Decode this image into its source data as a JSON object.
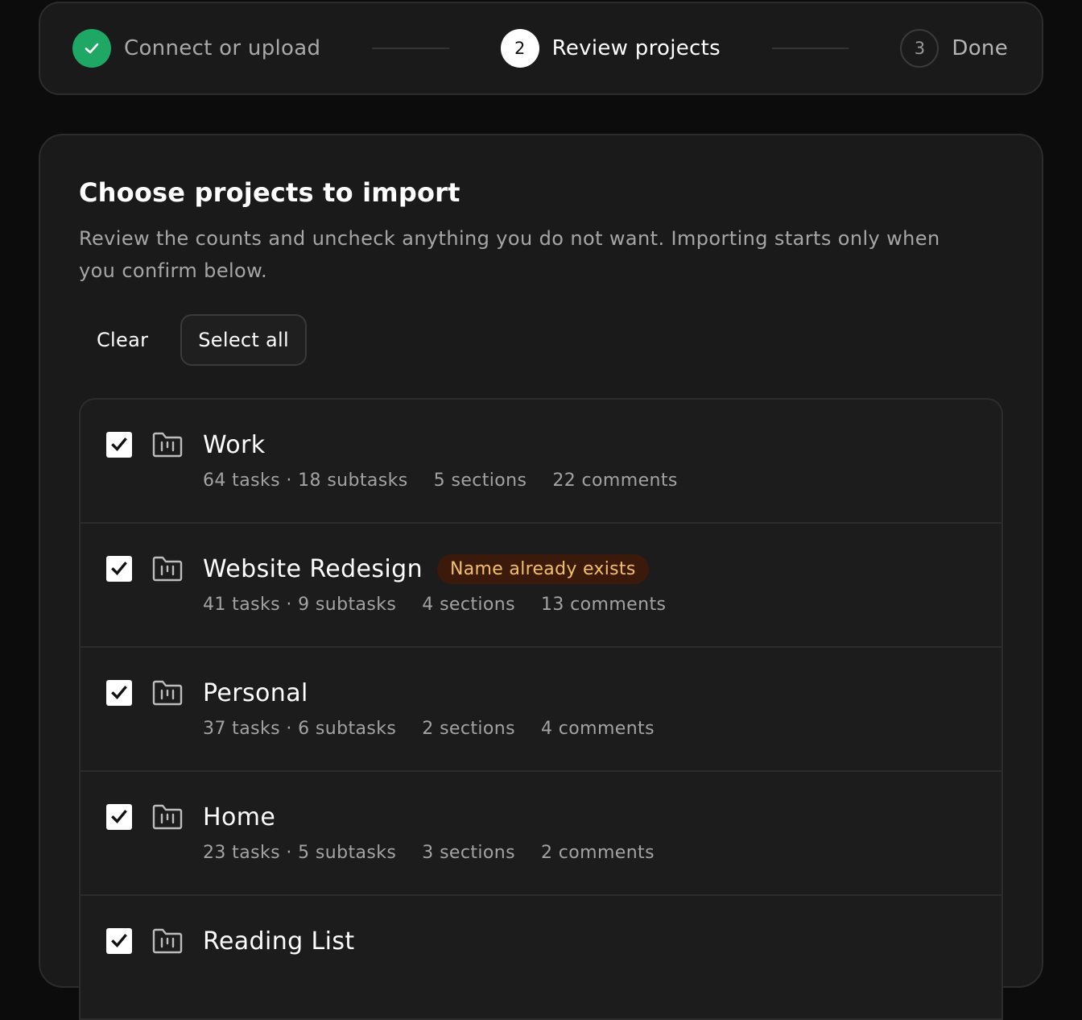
{
  "stepper": {
    "steps": [
      {
        "number": "",
        "label": "Connect or upload",
        "state": "done"
      },
      {
        "number": "2",
        "label": "Review projects",
        "state": "current"
      },
      {
        "number": "3",
        "label": "Done",
        "state": "future"
      }
    ]
  },
  "main": {
    "title": "Choose projects to import",
    "description": "Review the counts and uncheck anything you do not want. Importing starts only when you confirm below.",
    "actions": {
      "clear_label": "Clear",
      "select_all_label": "Select all"
    },
    "projects": [
      {
        "name": "Work",
        "badge": "",
        "tasks": "64 tasks · 18 subtasks",
        "sections": "5 sections",
        "comments": "22 comments",
        "checked": true
      },
      {
        "name": "Website Redesign",
        "badge": "Name already exists",
        "tasks": "41 tasks · 9 subtasks",
        "sections": "4 sections",
        "comments": "13 comments",
        "checked": true
      },
      {
        "name": "Personal",
        "badge": "",
        "tasks": "37 tasks · 6 subtasks",
        "sections": "2 sections",
        "comments": "4 comments",
        "checked": true
      },
      {
        "name": "Home",
        "badge": "",
        "tasks": "23 tasks · 5 subtasks",
        "sections": "3 sections",
        "comments": "2 comments",
        "checked": true
      },
      {
        "name": "Reading List",
        "badge": "",
        "tasks": "",
        "sections": "",
        "comments": "",
        "checked": true
      }
    ]
  },
  "colors": {
    "background": "#0c0c0c",
    "card": "#1a1a1a",
    "success": "#1fa865",
    "badge_bg": "#3b1a0c",
    "badge_text": "#f3c06a"
  },
  "icons": {
    "step_done": "check-icon",
    "project": "folder-board-icon",
    "checkbox": "checkmark-icon"
  }
}
